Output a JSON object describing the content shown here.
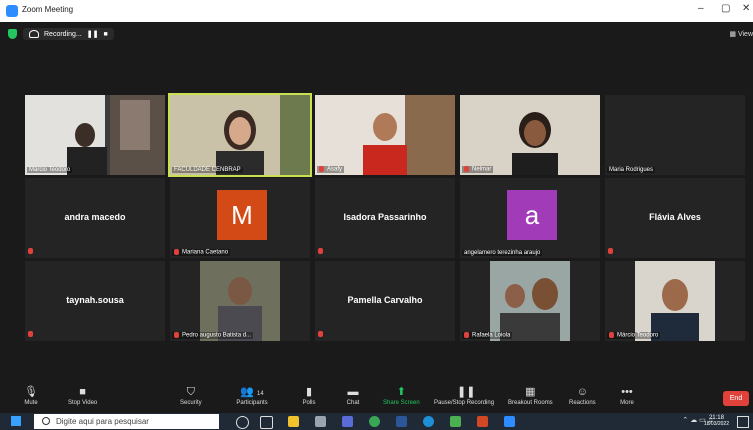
{
  "window": {
    "title": "Zoom Meeting",
    "min": "–",
    "restore": "▢",
    "close": "✕"
  },
  "recording": {
    "label": "Recording...",
    "pause": "❚❚",
    "stop": "■"
  },
  "view_label": "▦ View",
  "tiles": [
    {
      "name": "Márcio Teodoro",
      "kind": "video"
    },
    {
      "name": "FACULDADE CENBRAP",
      "kind": "video",
      "active": true
    },
    {
      "name": "Asafy",
      "kind": "video",
      "muted": true
    },
    {
      "name": "Nelmar",
      "kind": "video",
      "muted": true
    },
    {
      "name": "Maria Rodrigues",
      "kind": "blank"
    },
    {
      "name": "andra macedo",
      "kind": "name",
      "muted": true
    },
    {
      "name": "Mariana Caetano",
      "kind": "avatar",
      "letter": "M",
      "color": "#d44a16",
      "muted": true
    },
    {
      "name": "Isadora Passarinho",
      "kind": "name",
      "muted": true
    },
    {
      "name": "angelamero terezinha araujo",
      "kind": "avatar",
      "letter": "a",
      "color": "#a13bb7"
    },
    {
      "name": "Flávia Alves",
      "kind": "name",
      "muted": true
    },
    {
      "name": "taynah.sousa",
      "kind": "name",
      "muted": true
    },
    {
      "name": "Pedro augusto Batista d...",
      "kind": "video",
      "muted": true
    },
    {
      "name": "Pamella Carvalho",
      "kind": "name",
      "muted": true
    },
    {
      "name": "Rafaela Loiola",
      "kind": "video",
      "muted": true
    },
    {
      "name": "Márcio Teodoro",
      "kind": "video",
      "muted": true
    }
  ],
  "toolbar": {
    "mute": "Mute",
    "stop_video": "Stop Video",
    "security": "Security",
    "participants": "Participants",
    "participants_count": "14",
    "polls": "Polls",
    "chat": "Chat",
    "share_screen": "Share Screen",
    "pause_recording": "Pause/Stop Recording",
    "breakout": "Breakout Rooms",
    "reactions": "Reactions",
    "more": "More",
    "end": "End"
  },
  "taskbar": {
    "search_placeholder": "Digite aqui para pesquisar",
    "time": "21:18",
    "date": "18/03/2022"
  },
  "colors": {
    "accent": "#23c55e",
    "active_border": "#c9e052",
    "end": "#e0413a"
  }
}
